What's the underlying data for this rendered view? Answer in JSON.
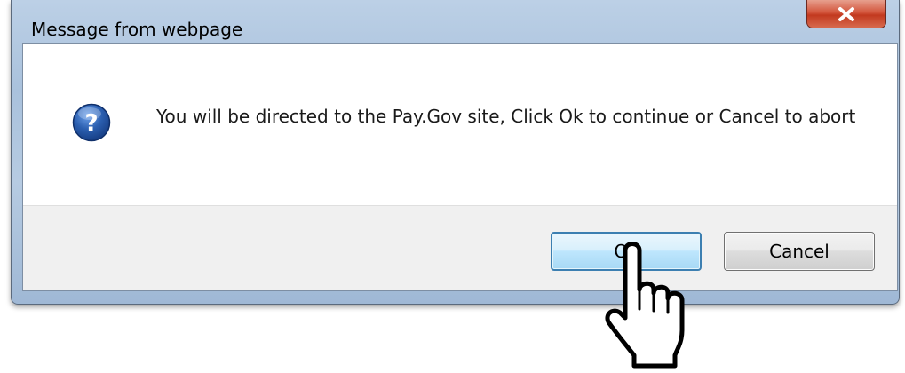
{
  "dialog": {
    "title": "Message from webpage",
    "message": "You will be directed to the Pay.Gov site, Click Ok to continue or Cancel to abort",
    "icon": "question-icon",
    "close_icon": "close-icon",
    "buttons": {
      "ok_label": "Ok",
      "cancel_label": "Cancel"
    }
  },
  "cursor": {
    "icon": "hand-pointer-icon"
  },
  "colors": {
    "title_bar": "#b6cbe2",
    "close_button": "#c2391f",
    "question_icon": "#2b5fb0",
    "ok_border": "#3c7fb1",
    "button_area": "#f0f0f0"
  }
}
